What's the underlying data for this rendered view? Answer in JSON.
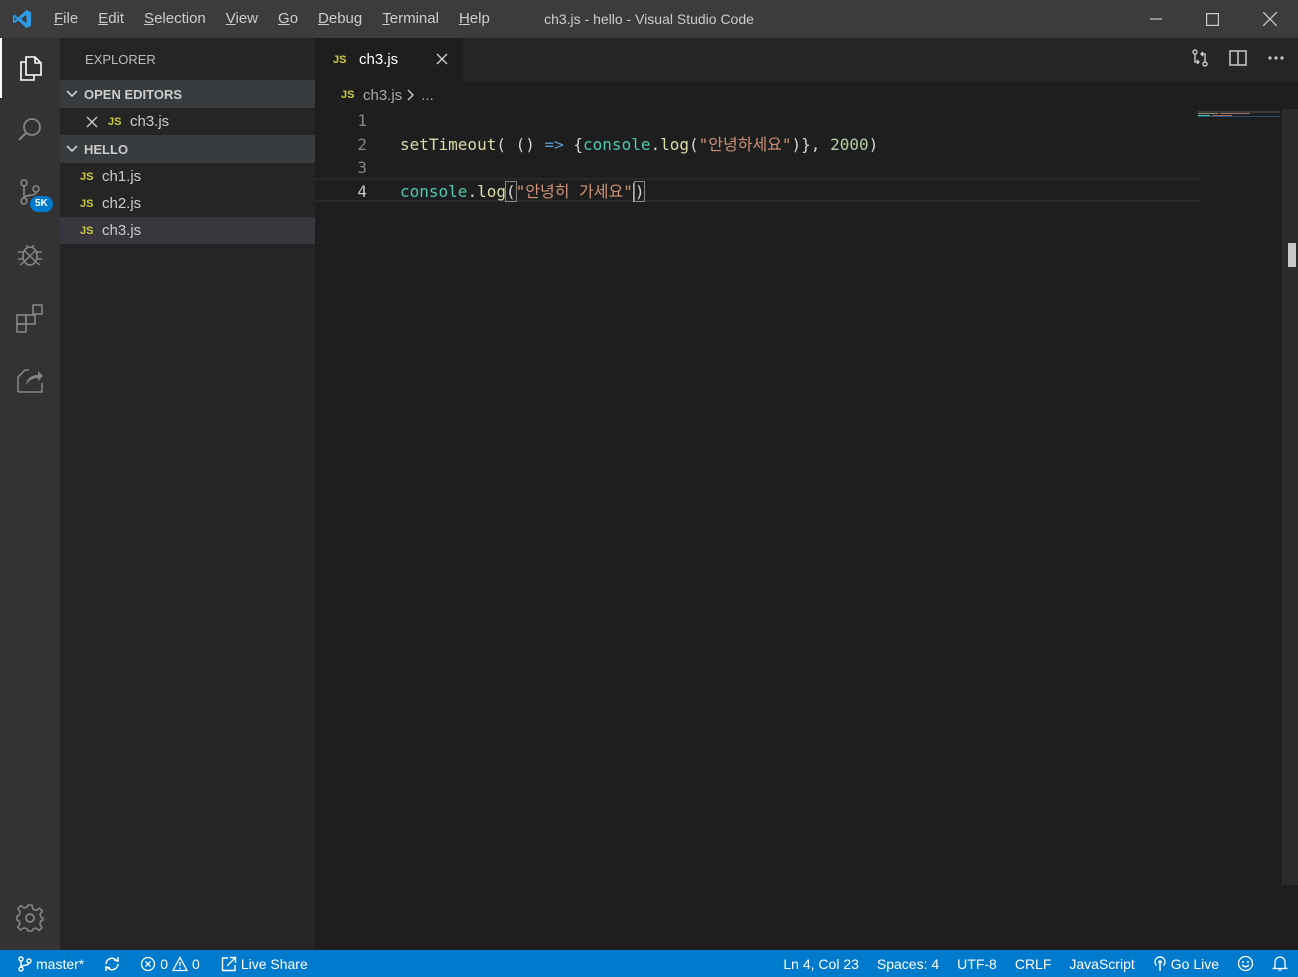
{
  "window": {
    "title": "ch3.js - hello - Visual Studio Code"
  },
  "menu": [
    {
      "access": "F",
      "rest": "ile"
    },
    {
      "access": "E",
      "rest": "dit"
    },
    {
      "access": "S",
      "rest": "election"
    },
    {
      "access": "V",
      "rest": "iew"
    },
    {
      "access": "G",
      "rest": "o"
    },
    {
      "access": "D",
      "rest": "ebug"
    },
    {
      "access": "T",
      "rest": "erminal"
    },
    {
      "access": "H",
      "rest": "elp"
    }
  ],
  "activity": {
    "scm_badge": "5K"
  },
  "explorer": {
    "title": "EXPLORER",
    "open_editors": {
      "label": "OPEN EDITORS",
      "files": [
        {
          "icon": "JS",
          "name": "ch3.js"
        }
      ]
    },
    "folder": {
      "label": "HELLO",
      "files": [
        {
          "icon": "JS",
          "name": "ch1.js"
        },
        {
          "icon": "JS",
          "name": "ch2.js"
        },
        {
          "icon": "JS",
          "name": "ch3.js",
          "selected": true
        }
      ]
    }
  },
  "editor": {
    "tab": {
      "icon": "JS",
      "label": "ch3.js"
    },
    "breadcrumb": {
      "icon": "JS",
      "file": "ch3.js",
      "more": "..."
    },
    "lines": [
      {
        "num": "1",
        "tokens": []
      },
      {
        "num": "2",
        "tokens": [
          {
            "t": "setTimeout",
            "c": "fn"
          },
          {
            "t": "( () ",
            "c": "pl"
          },
          {
            "t": "=>",
            "c": "kw"
          },
          {
            "t": " {",
            "c": "pl"
          },
          {
            "t": "console",
            "c": "var"
          },
          {
            "t": ".",
            "c": "pl"
          },
          {
            "t": "log",
            "c": "fn"
          },
          {
            "t": "(",
            "c": "pl"
          },
          {
            "t": "\"안녕하세요\"",
            "c": "str"
          },
          {
            "t": ")}, ",
            "c": "pl"
          },
          {
            "t": "2000",
            "c": "num"
          },
          {
            "t": ")",
            "c": "pl"
          }
        ]
      },
      {
        "num": "3",
        "tokens": []
      },
      {
        "num": "4",
        "current": true,
        "tokens": [
          {
            "t": "console",
            "c": "var"
          },
          {
            "t": ".",
            "c": "pl"
          },
          {
            "t": "log",
            "c": "fn"
          },
          {
            "t": "(",
            "c": "pl",
            "match": true
          },
          {
            "t": "\"안녕히 가세요\"",
            "c": "str"
          },
          {
            "t": ")",
            "c": "pl",
            "match": true,
            "cursor_before": true
          }
        ]
      }
    ]
  },
  "status": {
    "branch": "master*",
    "errors": "0",
    "warnings": "0",
    "live_share": "Live Share",
    "position": "Ln 4, Col 23",
    "spaces": "Spaces: 4",
    "encoding": "UTF-8",
    "eol": "CRLF",
    "language": "JavaScript",
    "go_live": "Go Live"
  },
  "colors": {
    "accent": "#007acc",
    "js_icon": "#cbcb41"
  }
}
